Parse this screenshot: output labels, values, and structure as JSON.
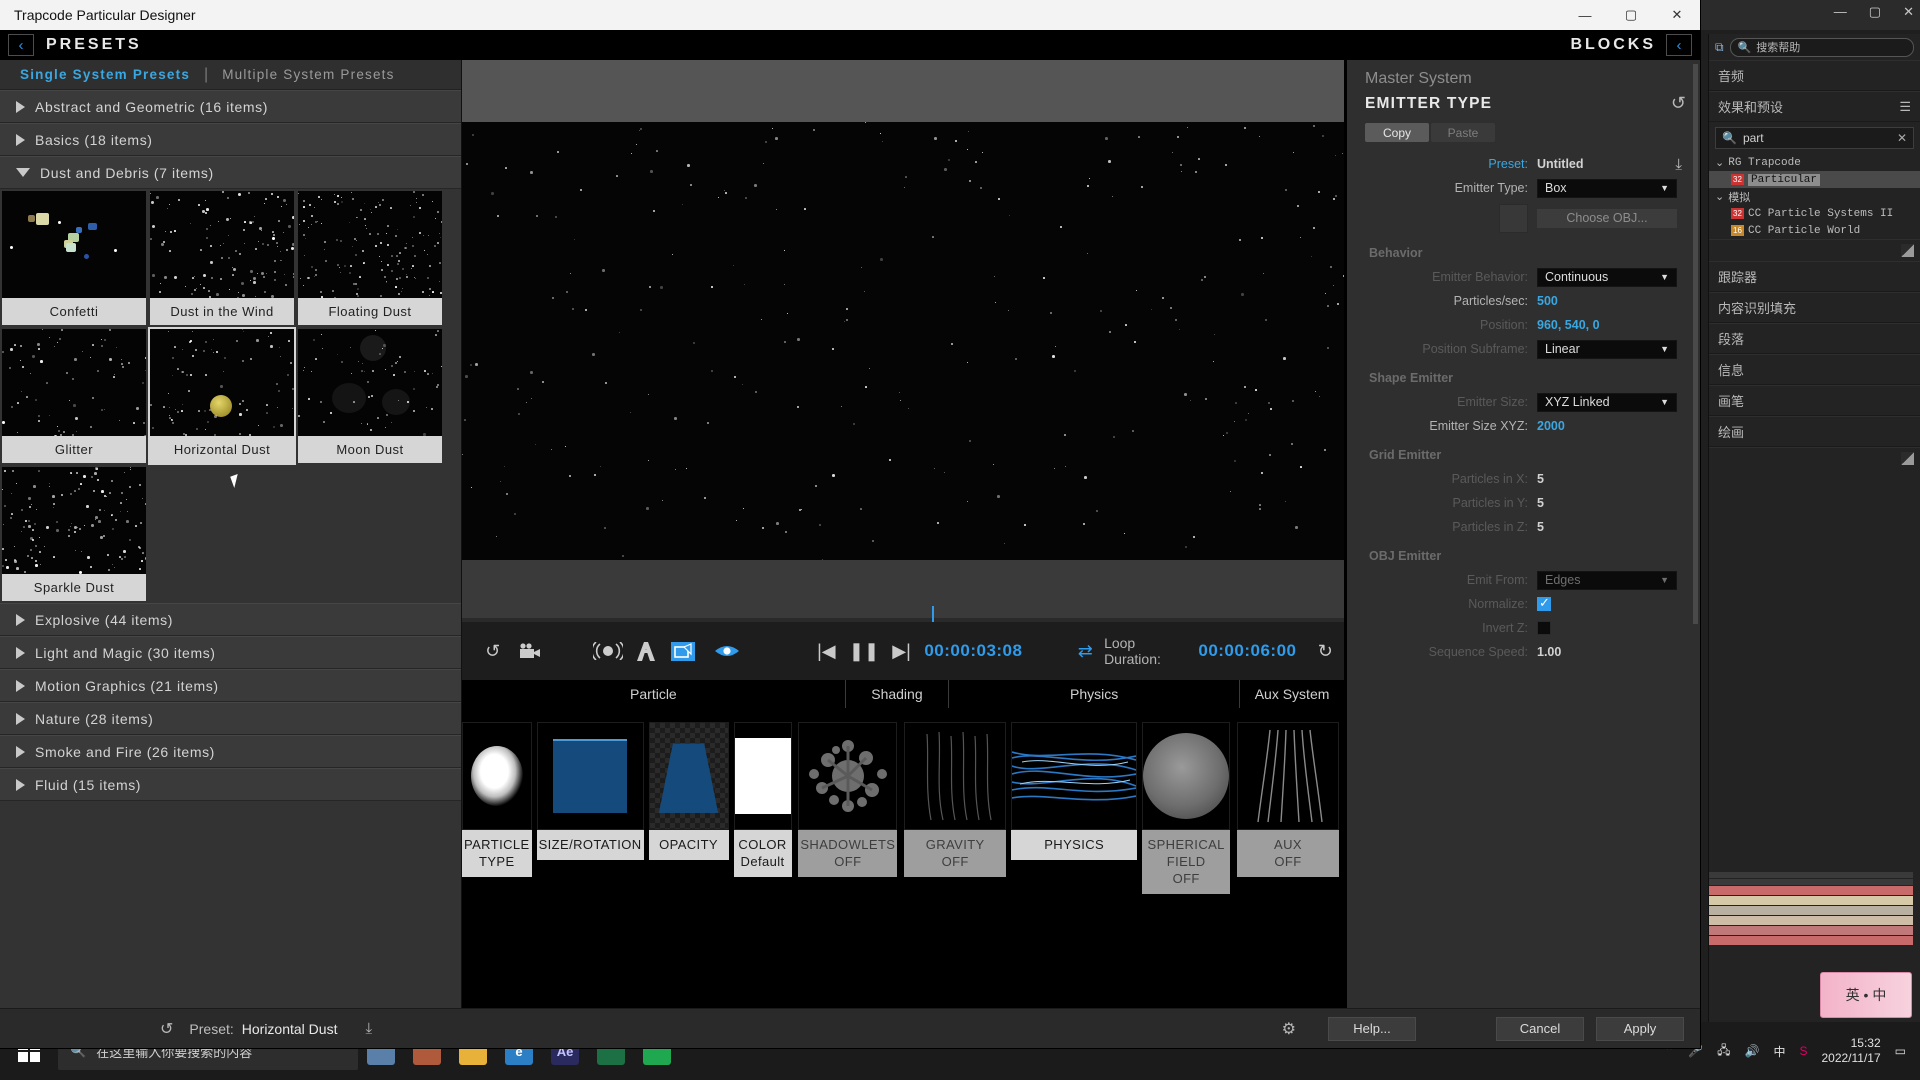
{
  "ae": {
    "search_placeholder": "搜索帮助",
    "sections": [
      {
        "label": "音频"
      },
      {
        "label": "效果和预设"
      },
      {
        "label": "跟踪器"
      },
      {
        "label": "内容识别填充"
      },
      {
        "label": "段落"
      },
      {
        "label": "信息"
      },
      {
        "label": "画笔"
      },
      {
        "label": "绘画"
      }
    ],
    "find_value": "part",
    "tree": [
      {
        "label": "RG Trapcode",
        "type": "group",
        "indent": 0
      },
      {
        "label": "Particular",
        "type": "effect",
        "indent": 1,
        "badge": "32",
        "selected": true
      },
      {
        "label": "模拟",
        "type": "group",
        "indent": 0
      },
      {
        "label": "CC Particle Systems II",
        "type": "effect",
        "indent": 1,
        "badge": "32"
      },
      {
        "label": "CC Particle World",
        "type": "effect",
        "indent": 1,
        "badge": "16"
      }
    ],
    "float_label": "英 • 中"
  },
  "taskbar": {
    "search_placeholder": "在这里输入你要搜索的内容",
    "clock_time": "15:32",
    "clock_date": "2022/11/17",
    "apps": [
      {
        "name": "photos-app",
        "label": "",
        "color": "#5a7fa8"
      },
      {
        "name": "store-app",
        "label": "",
        "color": "#b05a3c"
      },
      {
        "name": "explorer-app",
        "label": "",
        "color": "#e8b23a"
      },
      {
        "name": "edge-app",
        "label": "e",
        "color": "#2c7fc4"
      },
      {
        "name": "after-effects-app",
        "label": "Ae",
        "color": "#2a2a5e"
      },
      {
        "name": "excel-app",
        "label": "",
        "color": "#1d7044"
      },
      {
        "name": "notes-app",
        "label": "",
        "color": "#1fa84f"
      }
    ]
  },
  "window": {
    "title": "Trapcode Particular Designer",
    "minimize": "—",
    "maximize": "▢",
    "close": "✕"
  },
  "presets": {
    "header_title": "PRESETS",
    "back_icon": "‹",
    "tabs": [
      {
        "label": "Single System Presets",
        "active": true
      },
      {
        "label": "Multiple System Presets",
        "active": false
      }
    ],
    "tab_separator": "|",
    "categories": [
      {
        "label": "Abstract and Geometric (16 items)",
        "expanded": false
      },
      {
        "label": "Basics (18 items)",
        "expanded": false
      },
      {
        "label": "Dust and Debris (7 items)",
        "expanded": true
      },
      {
        "label": "Explosive (44 items)",
        "expanded": false
      },
      {
        "label": "Light and Magic (30 items)",
        "expanded": false
      },
      {
        "label": "Motion Graphics (21 items)",
        "expanded": false
      },
      {
        "label": "Nature (28 items)",
        "expanded": false
      },
      {
        "label": "Smoke and Fire (26 items)",
        "expanded": false
      },
      {
        "label": "Fluid (15 items)",
        "expanded": false
      }
    ],
    "items": [
      {
        "label": "Confetti",
        "selected": false
      },
      {
        "label": "Dust in the Wind",
        "selected": false
      },
      {
        "label": "Floating Dust",
        "selected": false
      },
      {
        "label": "Glitter",
        "selected": false
      },
      {
        "label": "Horizontal Dust",
        "selected": true
      },
      {
        "label": "Moon Dust",
        "selected": false
      },
      {
        "label": "Sparkle Dust",
        "selected": false
      }
    ]
  },
  "blocks": {
    "header_title": "BLOCKS",
    "collapse_icon": "‹",
    "sections": [
      {
        "label": "Particle"
      },
      {
        "label": "Shading"
      },
      {
        "label": "Physics"
      },
      {
        "label": "Aux System"
      }
    ],
    "cards": [
      {
        "label": "PARTICLE TYPE",
        "sub": "",
        "state": "on",
        "icon": "soft-sphere"
      },
      {
        "label": "SIZE/ROTATION",
        "sub": "",
        "state": "on",
        "icon": "size-curve"
      },
      {
        "label": "OPACITY",
        "sub": "",
        "state": "on",
        "icon": "opacity-curve"
      },
      {
        "label": "COLOR",
        "sub": "Default",
        "state": "on",
        "icon": "white-swatch"
      },
      {
        "label": "SHADOWLETS",
        "sub": "OFF",
        "state": "off",
        "icon": "shadowlets"
      },
      {
        "label": "GRAVITY",
        "sub": "OFF",
        "state": "off",
        "icon": "gravity"
      },
      {
        "label": "PHYSICS",
        "sub": "",
        "state": "on",
        "icon": "physics-streaks"
      },
      {
        "label": "SPHERICAL FIELD",
        "sub": "OFF",
        "state": "off",
        "icon": "spherical-field"
      },
      {
        "label": "AUX",
        "sub": "OFF",
        "state": "off",
        "icon": "aux-streaks"
      }
    ]
  },
  "transport": {
    "reset_icon": "↺",
    "camera_icon": "camera",
    "motion_blur_icon": "((●))",
    "depth_icon": "A",
    "bounds_icon": "▣",
    "visibility_icon": "eye",
    "first_frame_icon": "|◀",
    "pause_icon": "❚❚",
    "next_frame_icon": "▶|",
    "current_time": "00:00:03:08",
    "loop_icon": "⇄",
    "loop_label": "Loop Duration:",
    "loop_duration": "00:00:06:00",
    "loop_reset_icon": "↻"
  },
  "params": {
    "system_label": "Master System",
    "title": "EMITTER TYPE",
    "reset_icon": "↺",
    "copy_label": "Copy",
    "paste_label": "Paste",
    "preset_label": "Preset:",
    "preset_value": "Untitled",
    "save_icon": "⤓",
    "emitter_type_label": "Emitter Type:",
    "emitter_type_value": "Box",
    "choose_obj_label": "Choose OBJ...",
    "groups": {
      "behavior": "Behavior",
      "shape_emitter": "Shape Emitter",
      "grid_emitter": "Grid Emitter",
      "obj_emitter": "OBJ Emitter"
    },
    "rows": [
      {
        "label": "Emitter Behavior:",
        "value": "Continuous",
        "kind": "select",
        "dim": true
      },
      {
        "label": "Particles/sec:",
        "value": "500",
        "kind": "number",
        "dim": false
      },
      {
        "label": "Position:",
        "value": "960, 540, 0",
        "kind": "number",
        "dim": true
      },
      {
        "label": "Position Subframe:",
        "value": "Linear",
        "kind": "select",
        "dim": true
      },
      {
        "label": "Emitter Size:",
        "value": "XYZ Linked",
        "kind": "select",
        "dim": true
      },
      {
        "label": "Emitter Size XYZ:",
        "value": "2000",
        "kind": "number",
        "dim": false
      },
      {
        "label": "Particles in X:",
        "value": "5",
        "kind": "number-gray",
        "dim": true
      },
      {
        "label": "Particles in Y:",
        "value": "5",
        "kind": "number-gray",
        "dim": true
      },
      {
        "label": "Particles in Z:",
        "value": "5",
        "kind": "number-gray",
        "dim": true
      },
      {
        "label": "Emit From:",
        "value": "Edges",
        "kind": "select-dim",
        "dim": true
      },
      {
        "label": "Normalize:",
        "value": "checked",
        "kind": "checkbox-on",
        "dim": true
      },
      {
        "label": "Invert Z:",
        "value": "unchecked",
        "kind": "checkbox-off",
        "dim": true
      },
      {
        "label": "Sequence Speed:",
        "value": "1.00",
        "kind": "number-gray",
        "dim": true
      }
    ]
  },
  "footer": {
    "reset_icon": "↺",
    "preset_label": "Preset:",
    "preset_value": "Horizontal Dust",
    "save_icon": "⤓",
    "gear_icon": "⚙",
    "help_label": "Help...",
    "cancel_label": "Cancel",
    "apply_label": "Apply"
  },
  "colors": {
    "accent_blue": "#2f9bea",
    "panel_bg": "#2f2f2f",
    "caption_bg": "#d6d6d6"
  }
}
